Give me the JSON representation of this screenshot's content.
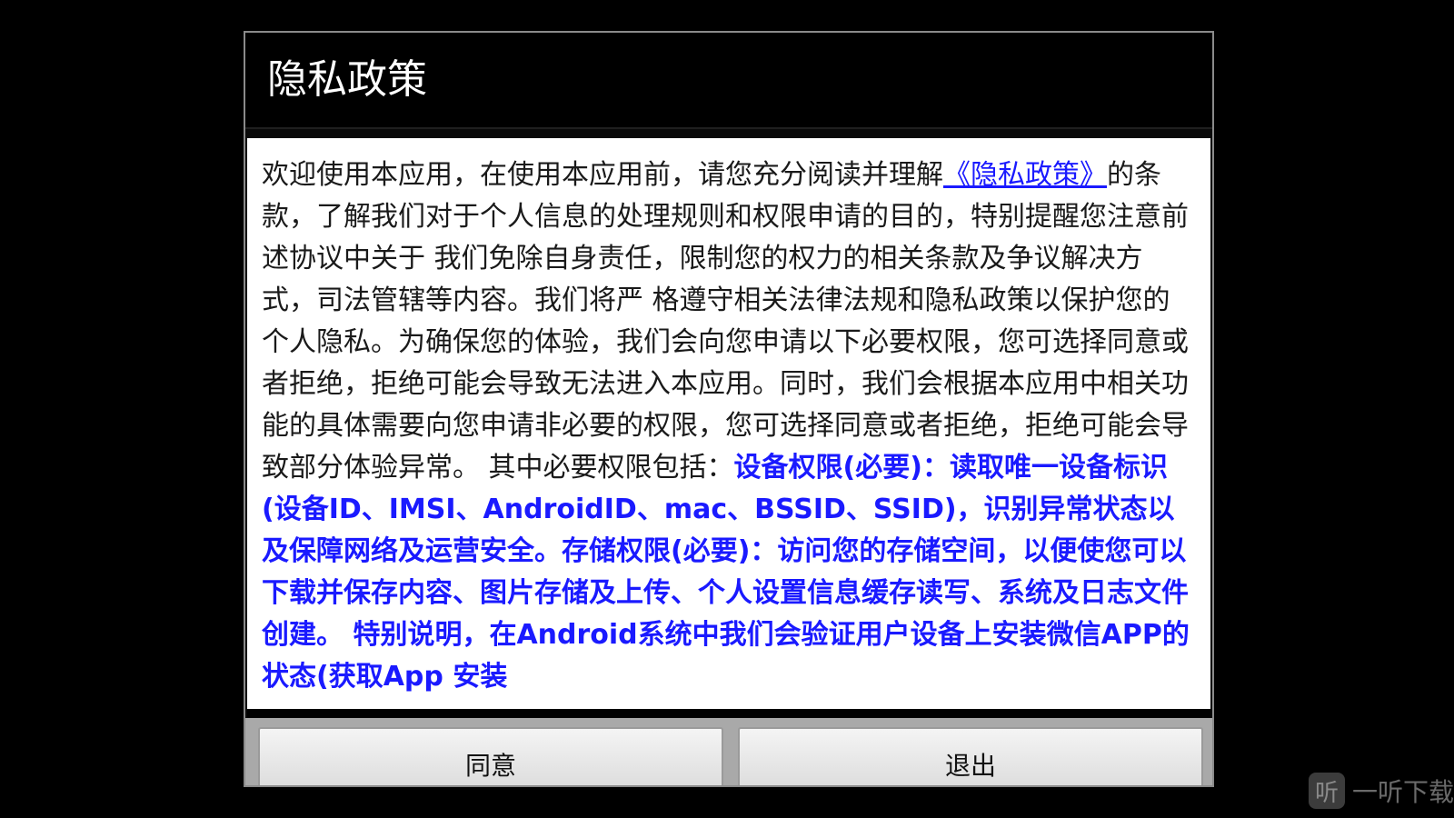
{
  "dialog": {
    "title": "隐私政策",
    "content": {
      "intro_before_link": "欢迎使用本应用，在使用本应用前，请您充分阅读并理解",
      "policy_link": "《隐私政策》",
      "intro_after_link": "的条款，了解我们对于个人信息的处理规则和权限申请的目的，特别提醒您注意前述协议中关于 我们免除自身责任，限制您的权力的相关条款及争议解决方式，司法管辖等内容。我们将严 格遵守相关法律法规和隐私政策以保护您的个人隐私。为确保您的体验，我们会向您申请以下必要权限，您可选择同意或者拒绝，拒绝可能会导致无法进入本应用。同时，我们会根据本应用中相关功能的具体需要向您申请非必要的权限，您可选择同意或者拒绝，拒绝可能会导致部分体验异常。 其中必要权限包括：",
      "permissions_text": "设备权限(必要)：读取唯一设备标识 (设备ID、IMSI、AndroidID、mac、BSSID、SSID)，识别异常状态以及保障网络及运营安全。存储权限(必要)：访问您的存储空间，以便使您可以下载并保存内容、图片存储及上传、个人设置信息缓存读写、系统及日志文件创建。 特别说明，在Android系统中我们会验证用户设备上安装微信APP的状态(获取App 安装"
    },
    "buttons": {
      "agree": "同意",
      "exit": "退出"
    }
  },
  "watermark": {
    "icon_glyph": "听",
    "text": "一听下载"
  },
  "colors": {
    "background": "#000000",
    "link": "#1a1aff",
    "content_bg": "#ffffff"
  }
}
